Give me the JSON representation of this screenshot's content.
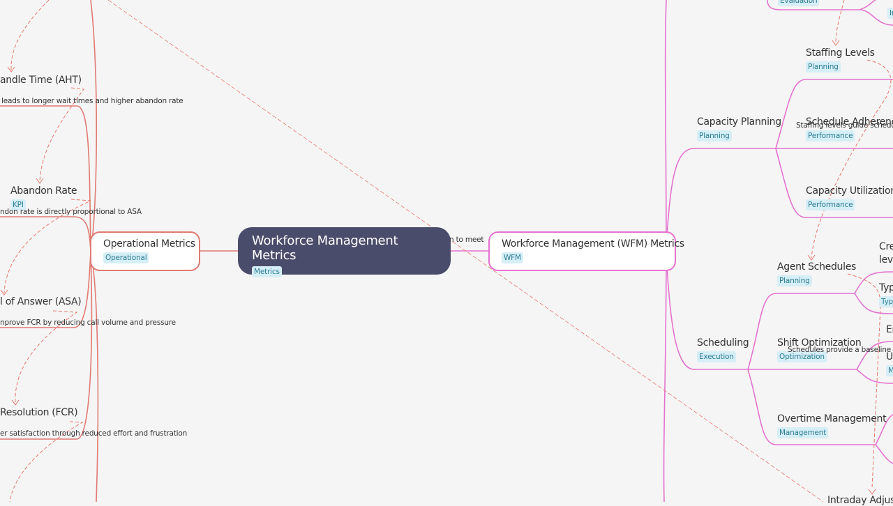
{
  "root": {
    "title": "Workforce Management Metrics",
    "tag": "Metrics"
  },
  "left_branch": {
    "title": "Operational Metrics",
    "tag": "Operational",
    "color": "#e07a72",
    "children": [
      {
        "title": "andle Time (AHT)",
        "note": "leads to longer wait times and higher abandon rate"
      },
      {
        "title": "Abandon Rate",
        "tag": "KPI",
        "note": "ndon rate is directly proportional to ASA"
      },
      {
        "title": "l of Answer (ASA)",
        "note": "nprove FCR by reducing call volume and pressure"
      },
      {
        "title": "Resolution (FCR)",
        "note": "er satisfaction through reduced effort and frustration"
      }
    ]
  },
  "right_branch": {
    "title": "Workforce Management (WFM) Metrics",
    "tag": "WFM",
    "color": "#e472d0",
    "link_note": "n to meet",
    "top_partial": {
      "tag": "Evaluation",
      "right_tag": "In"
    },
    "groups": [
      {
        "title": "Capacity Planning",
        "tag": "Planning",
        "children": [
          {
            "title": "Staffing Levels",
            "tag": "Planning"
          },
          {
            "title": "Schedule Adherence",
            "tag": "Performance"
          },
          {
            "title": "Capacity Utilization",
            "tag": "Performance"
          }
        ],
        "note": "Staffing levels guide schedu"
      },
      {
        "title": "Scheduling",
        "tag": "Execution",
        "children": [
          {
            "title": "Agent Schedules",
            "tag": "Planning"
          },
          {
            "title": "Shift Optimization",
            "tag": "Optimization"
          },
          {
            "title": "Overtime Management",
            "tag": "Management"
          }
        ],
        "note": "Schedules provide a baseline"
      }
    ],
    "far_right": [
      {
        "title": "Cre"
      },
      {
        "title": "leve"
      },
      {
        "title": "Typ",
        "tag": "Typ"
      },
      {
        "title": "Er"
      },
      {
        "title": "U",
        "tag": "M"
      }
    ],
    "bottom_partial": "Intraday Adjustr"
  }
}
